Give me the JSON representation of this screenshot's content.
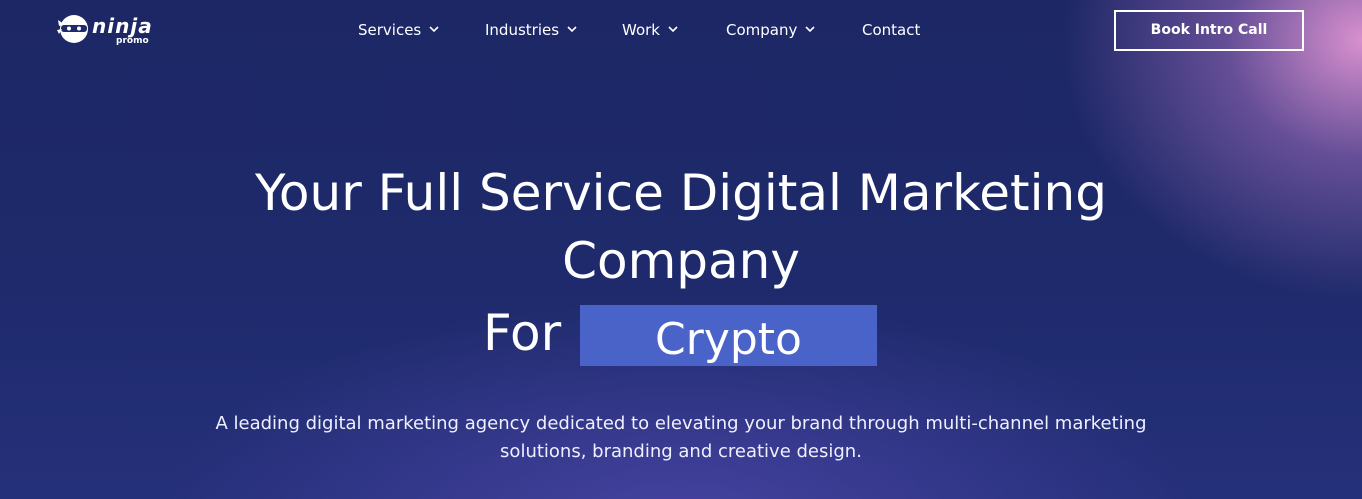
{
  "brand": {
    "name": "ninja",
    "tagline": "promo"
  },
  "nav": {
    "items": [
      {
        "label": "Services",
        "has_dropdown": true
      },
      {
        "label": "Industries",
        "has_dropdown": true
      },
      {
        "label": "Work",
        "has_dropdown": true
      },
      {
        "label": "Company",
        "has_dropdown": true
      },
      {
        "label": "Contact",
        "has_dropdown": false
      }
    ],
    "cta_label": "Book Intro Call"
  },
  "hero": {
    "title_line1": "Your Full Service Digital Marketing",
    "title_line2": "Company",
    "for_prefix": "For",
    "rotating_word": "Crypto",
    "description_line1": "A leading digital marketing agency dedicated to elevating your brand through multi-channel marketing",
    "description_line2": "solutions, branding and creative design."
  },
  "colors": {
    "background": "#1e2a6b",
    "highlight": "#4a63c9",
    "accent_glow": "#e296d4",
    "text": "#ffffff"
  },
  "icons": {
    "logo": "ninja-mask-icon",
    "dropdown": "chevron-down-icon"
  }
}
